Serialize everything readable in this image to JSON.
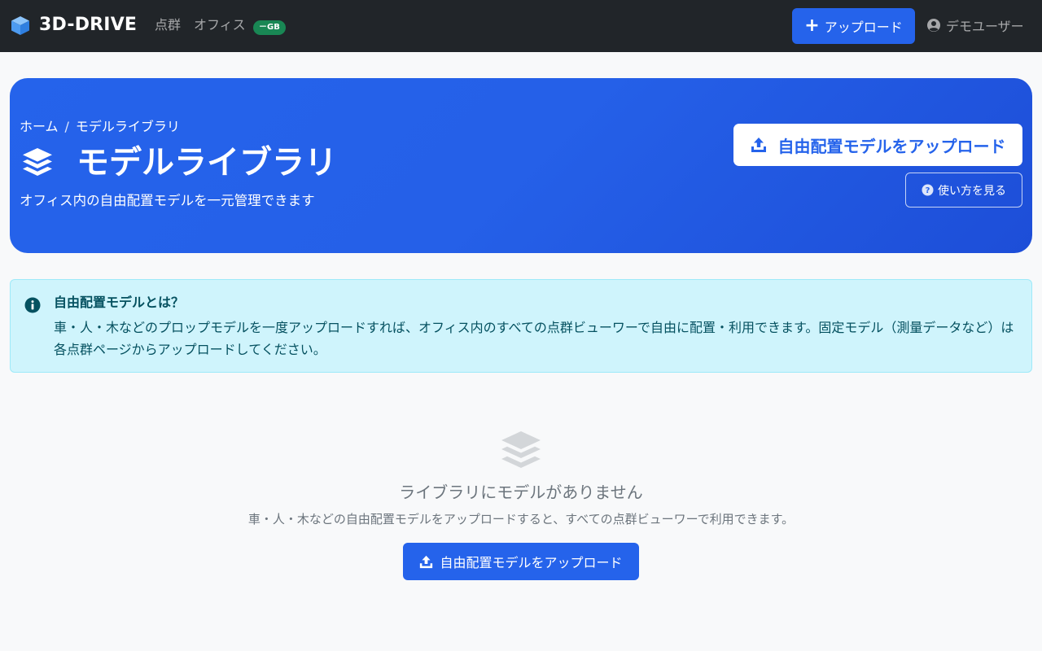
{
  "navbar": {
    "brand": "3D-DRIVE",
    "links": [
      "点群",
      "オフィス"
    ],
    "office_badge": "－GB",
    "upload_label": "アップロード",
    "user_name": "デモユーザー",
    "brand_icon": "cube-icon",
    "colors": {
      "bg": "#212529",
      "brand_icon": "#5aa6f5",
      "badge": "#198754",
      "primary": "#2563eb"
    }
  },
  "hero": {
    "breadcrumb": {
      "home": "ホーム",
      "separator": "/",
      "current": "モデルライブラリ"
    },
    "title": "モデルライブラリ",
    "title_icon": "layers-icon",
    "subtitle": "オフィス内の自由配置モデルを一元管理できます",
    "upload_button": "自由配置モデルをアップロード",
    "howto_button": "使い方を見る",
    "colors": {
      "gradient_start": "#2563eb",
      "gradient_end": "#1d4ed8"
    }
  },
  "info": {
    "title": "自由配置モデルとは？",
    "body": "車・人・木などのプロップモデルを一度アップロードすれば、オフィス内のすべての点群ビューワーで自由に配置・利用できます。固定モデル（測量データなど）は各点群ページからアップロードしてください。",
    "icon": "info-icon",
    "colors": {
      "bg": "#cff4fc",
      "border": "#9eeaf9",
      "text": "#055160"
    }
  },
  "empty": {
    "icon": "layers-icon",
    "title": "ライブラリにモデルがありません",
    "description": "車・人・木などの自由配置モデルをアップロードすると、すべての点群ビューワーで利用できます。",
    "upload_button": "自由配置モデルをアップロード"
  }
}
